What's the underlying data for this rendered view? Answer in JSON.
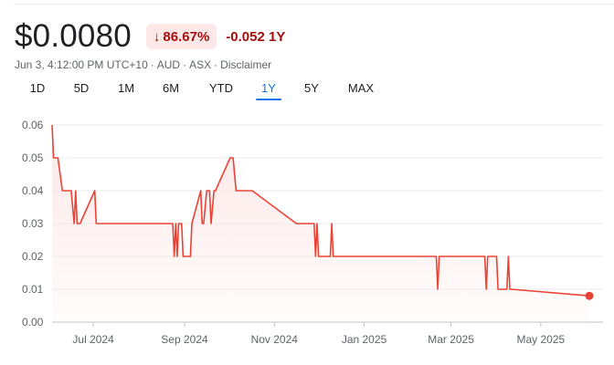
{
  "quote": {
    "price": "$0.0080",
    "change_pct": "86.67%",
    "change_abs": "-0.052 1Y",
    "meta": [
      "Jun 3, 4:12:00 PM UTC+10",
      "AUD",
      "ASX",
      "Disclaimer"
    ],
    "accent_color": "#a50e0e"
  },
  "tabs": [
    "1D",
    "5D",
    "1M",
    "6M",
    "YTD",
    "1Y",
    "5Y",
    "MAX"
  ],
  "active_tab": "1Y",
  "chart_data": {
    "type": "area",
    "line_color": "#ea4335",
    "fill_color": "#fce8e6",
    "grid": true,
    "ylim": [
      0,
      0.06
    ],
    "yticks": [
      0.0,
      0.01,
      0.02,
      0.03,
      0.04,
      0.05,
      0.06
    ],
    "ytick_labels": [
      "0.00",
      "0.01",
      "0.02",
      "0.03",
      "0.04",
      "0.05",
      "0.06"
    ],
    "xlim": [
      "2024-06-03",
      "2025-06-03"
    ],
    "xticks": [
      "2024-07-01",
      "2024-09-01",
      "2024-11-01",
      "2025-01-01",
      "2025-03-01",
      "2025-05-01"
    ],
    "xtick_labels": [
      "Jul 2024",
      "Sep 2024",
      "Nov 2024",
      "Jan 2025",
      "Mar 2025",
      "May 2025"
    ],
    "series": [
      {
        "x": [
          "2024-06-03",
          "2024-06-04",
          "2024-06-07",
          "2024-06-10",
          "2024-06-16",
          "2024-06-18",
          "2024-06-19",
          "2024-06-20",
          "2024-06-22",
          "2024-07-02",
          "2024-07-03",
          "2024-07-04",
          "2024-08-24",
          "2024-08-25",
          "2024-08-26",
          "2024-08-27",
          "2024-08-28",
          "2024-08-30",
          "2024-08-31",
          "2024-09-05",
          "2024-09-06",
          "2024-09-12",
          "2024-09-13",
          "2024-09-14",
          "2024-09-16",
          "2024-09-18",
          "2024-09-19",
          "2024-09-21",
          "2024-09-22",
          "2024-10-02",
          "2024-10-04",
          "2024-10-06",
          "2024-10-14",
          "2024-10-15",
          "2024-10-17",
          "2024-11-16",
          "2024-11-28",
          "2024-11-29",
          "2024-11-30",
          "2024-12-01",
          "2024-12-02",
          "2024-12-09",
          "2024-12-10",
          "2024-12-11",
          "2025-02-19",
          "2025-02-20",
          "2025-02-21",
          "2025-03-24",
          "2025-03-25",
          "2025-03-26",
          "2025-03-27",
          "2025-04-01",
          "2025-04-02",
          "2025-04-08",
          "2025-04-09",
          "2025-04-10",
          "2025-04-11",
          "2025-06-03"
        ],
        "y": [
          0.06,
          0.05,
          0.05,
          0.04,
          0.04,
          0.03,
          0.04,
          0.03,
          0.03,
          0.04,
          0.03,
          0.03,
          0.03,
          0.02,
          0.03,
          0.02,
          0.03,
          0.03,
          0.02,
          0.02,
          0.03,
          0.04,
          0.03,
          0.03,
          0.04,
          0.04,
          0.03,
          0.04,
          0.04,
          0.05,
          0.05,
          0.04,
          0.04,
          0.04,
          0.04,
          0.03,
          0.03,
          0.02,
          0.03,
          0.02,
          0.02,
          0.02,
          0.03,
          0.02,
          0.02,
          0.01,
          0.02,
          0.02,
          0.01,
          0.02,
          0.02,
          0.02,
          0.01,
          0.01,
          0.02,
          0.01,
          0.01,
          0.008
        ]
      }
    ]
  }
}
